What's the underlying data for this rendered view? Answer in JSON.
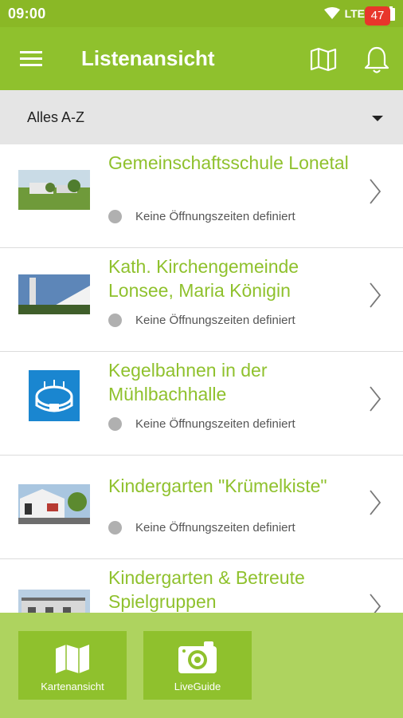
{
  "status_bar": {
    "time": "09:00",
    "network": "LTE",
    "icons": [
      "wifi-icon",
      "signal-icon",
      "battery-icon"
    ]
  },
  "app_bar": {
    "title": "Listenansicht",
    "notification_count": "47",
    "icons": [
      "menu-icon",
      "map-icon",
      "bell-icon"
    ]
  },
  "filter": {
    "selected": "Alles A-Z"
  },
  "list": {
    "items": [
      {
        "name": "Gemeinschaftsschule Lonetal",
        "hours": "Keine Öffnungszeiten definiert"
      },
      {
        "name": "Kath. Kirchengemeinde Lonsee, Maria Königin",
        "hours": "Keine Öffnungszeiten definiert"
      },
      {
        "name": "Kegelbahnen in der Mühlbachhalle",
        "hours": "Keine Öffnungszeiten definiert"
      },
      {
        "name": "Kindergarten \"Krümelkiste\"",
        "hours": "Keine Öffnungszeiten definiert"
      },
      {
        "name": "Kindergarten & Betreute Spielgruppen",
        "hours": ""
      }
    ]
  },
  "bottom_bar": {
    "buttons": [
      {
        "label": "Kartenansicht",
        "icon": "folded-map-icon"
      },
      {
        "label": "LiveGuide",
        "icon": "camera-icon"
      }
    ]
  },
  "colors": {
    "status_bar": "#8ab826",
    "app_bar": "#8fc12d",
    "accent_text": "#8fc12d",
    "badge": "#e8362b",
    "bottom_bar": "#aed35f",
    "stadium_icon_bg": "#1a86d0"
  }
}
